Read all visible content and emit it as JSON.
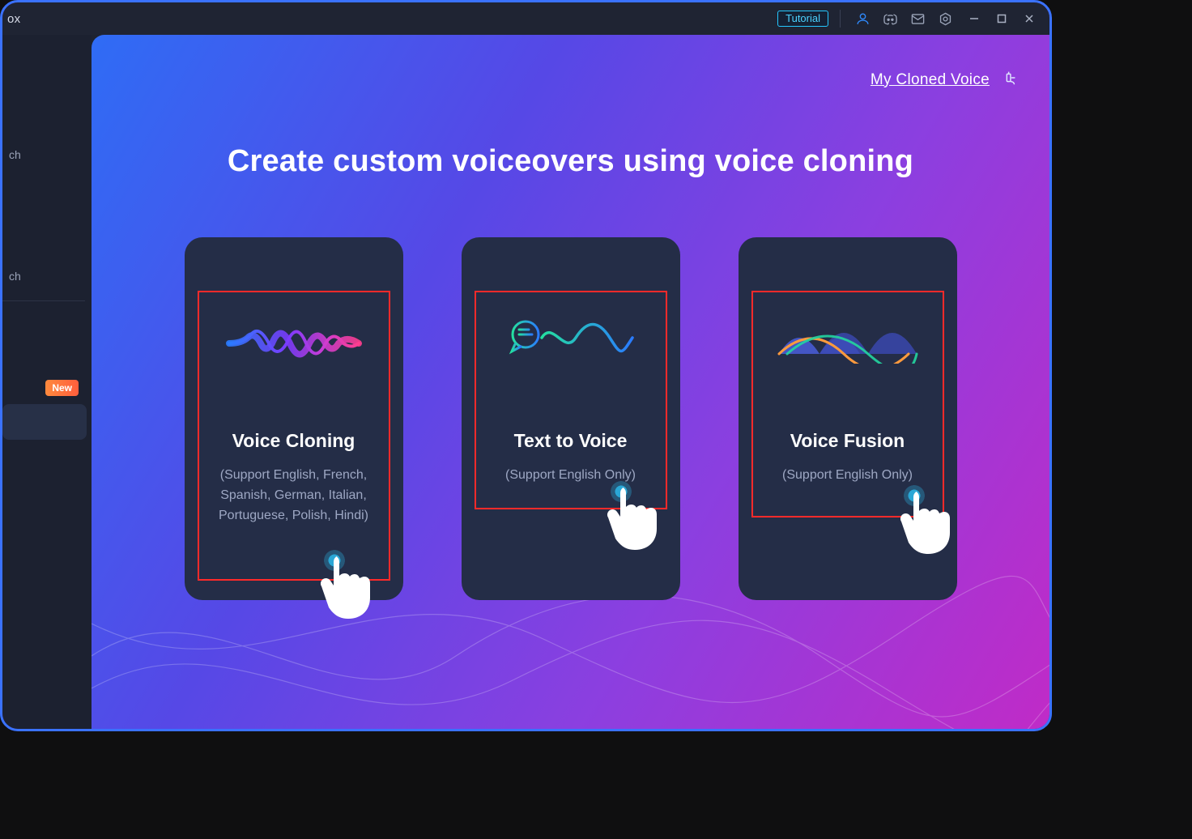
{
  "titlebar": {
    "app_title": "ox",
    "tutorial_label": "Tutorial"
  },
  "sidebar": {
    "items": [
      {
        "label": "ch"
      },
      {
        "label": "ch"
      },
      {
        "label": ""
      },
      {
        "label": ""
      }
    ],
    "badge": "New"
  },
  "top_links": {
    "cloned_voice": "My Cloned Voice"
  },
  "headline": "Create custom voiceovers using voice cloning",
  "cards": [
    {
      "title": "Voice Cloning",
      "subtitle": "(Support English, French, Spanish, German, Italian, Portuguese, Polish, Hindi)"
    },
    {
      "title": "Text to Voice",
      "subtitle": "(Support English Only)"
    },
    {
      "title": "Voice Fusion",
      "subtitle": "(Support English Only)"
    }
  ]
}
